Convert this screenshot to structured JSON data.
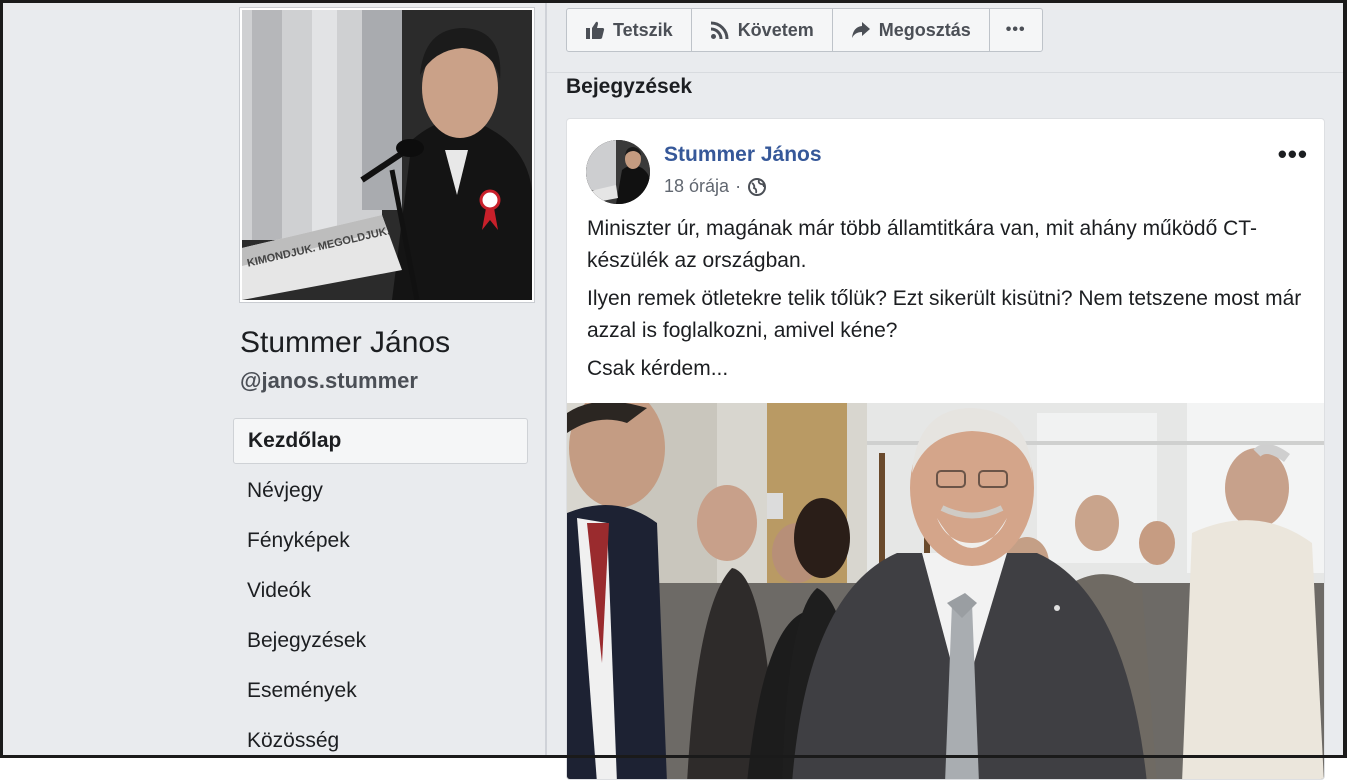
{
  "profile": {
    "name": "Stummer János",
    "handle": "@janos.stummer",
    "cover_banner_text": "KIMONDJUK. MEGOLDJUK."
  },
  "nav": {
    "items": [
      {
        "label": "Kezdőlap",
        "active": true
      },
      {
        "label": "Névjegy"
      },
      {
        "label": "Fényképek"
      },
      {
        "label": "Videók"
      },
      {
        "label": "Bejegyzések"
      },
      {
        "label": "Események"
      },
      {
        "label": "Közösség"
      }
    ]
  },
  "actions": {
    "like": {
      "label": "Tetszik",
      "icon": "thumbs-up-icon"
    },
    "follow": {
      "label": "Követem",
      "icon": "rss-icon"
    },
    "share": {
      "label": "Megosztás",
      "icon": "share-arrow-icon"
    },
    "more": {
      "label": "•••",
      "icon": "more-dots-icon"
    }
  },
  "section": {
    "title": "Bejegyzések"
  },
  "post": {
    "author": "Stummer János",
    "time": "18 órája",
    "separator": "·",
    "audience_icon": "globe-icon",
    "more": "•••",
    "paragraphs": [
      "Miniszter úr, magának már több államtitkára van, mit ahány működő CT-készülék az országban.",
      "Ilyen remek ötletekre telik tőlük? Ezt sikerült kisütni? Nem tetszene most már azzal is foglalkozni, amivel kéne?",
      "Csak kérdem..."
    ]
  },
  "colors": {
    "page_background": "#e9ebee",
    "author_link": "#365899",
    "button_text": "#4b4f56"
  }
}
